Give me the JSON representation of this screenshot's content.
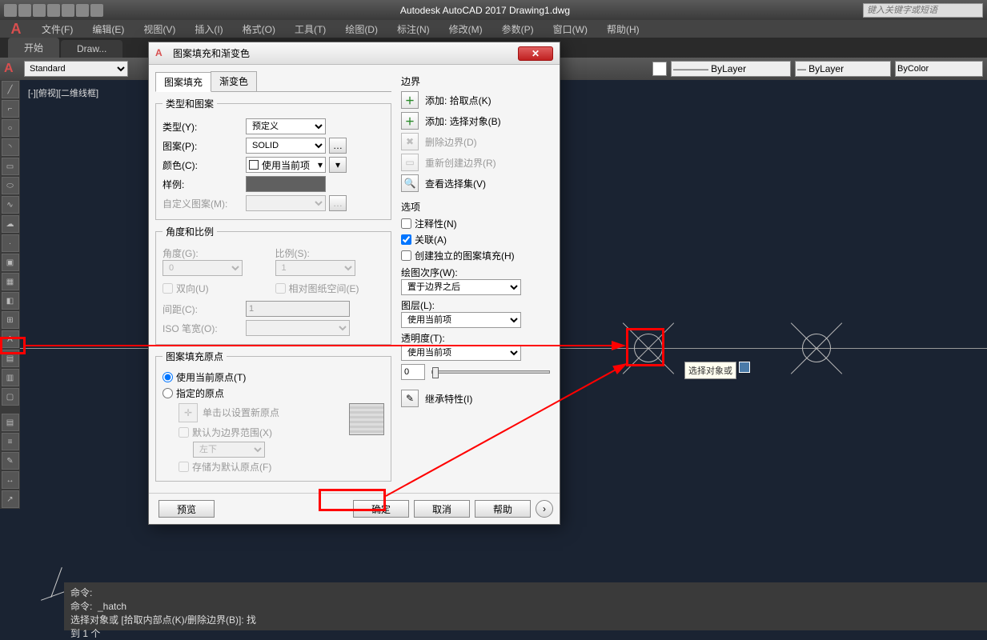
{
  "titlebar": {
    "title": "Autodesk AutoCAD 2017   Drawing1.dwg",
    "search_placeholder": "键入关键字或短语"
  },
  "menu": {
    "items": [
      "文件(F)",
      "编辑(E)",
      "视图(V)",
      "插入(I)",
      "格式(O)",
      "工具(T)",
      "绘图(D)",
      "标注(N)",
      "修改(M)",
      "参数(P)",
      "窗口(W)",
      "帮助(H)"
    ]
  },
  "tabs": {
    "start": "开始",
    "current": "Draw..."
  },
  "ribbon": {
    "style": "Standard",
    "layer": "ByLayer",
    "lineweight": "ByLayer",
    "color": "ByColor"
  },
  "viewport_label": "[-][俯视][二维线框]",
  "dialog": {
    "title": "图案填充和渐变色",
    "tabs": {
      "hatch": "图案填充",
      "gradient": "渐变色"
    },
    "type_group": {
      "legend": "类型和图案",
      "type_label": "类型(Y):",
      "type_value": "预定义",
      "pattern_label": "图案(P):",
      "pattern_value": "SOLID",
      "color_label": "颜色(C):",
      "color_value": "使用当前项",
      "sample_label": "样例:",
      "custom_label": "自定义图案(M):"
    },
    "angle_group": {
      "legend": "角度和比例",
      "angle_label": "角度(G):",
      "angle_value": "0",
      "scale_label": "比例(S):",
      "scale_value": "1",
      "double_label": "双向(U)",
      "relpaper_label": "相对图纸空间(E)",
      "spacing_label": "间距(C):",
      "spacing_value": "1",
      "iso_label": "ISO 笔宽(O):"
    },
    "origin_group": {
      "legend": "图案填充原点",
      "use_current": "使用当前原点(T)",
      "specified": "指定的原点",
      "click_set": "单击以设置新原点",
      "default_extent": "默认为边界范围(X)",
      "default_pos": "左下",
      "store_default": "存储为默认原点(F)"
    },
    "boundary": {
      "legend": "边界",
      "add_pick": "添加: 拾取点(K)",
      "add_select": "添加: 选择对象(B)",
      "remove": "删除边界(D)",
      "recreate": "重新创建边界(R)",
      "view_sel": "查看选择集(V)"
    },
    "options": {
      "legend": "选项",
      "annotative": "注释性(N)",
      "associative": "关联(A)",
      "separate": "创建独立的图案填充(H)",
      "draw_order_label": "绘图次序(W):",
      "draw_order_value": "置于边界之后",
      "layer_label": "图层(L):",
      "layer_value": "使用当前项",
      "transparency_label": "透明度(T):",
      "transparency_value": "使用当前项",
      "transparency_num": "0"
    },
    "inherit": "继承特性(I)",
    "footer": {
      "preview": "预览",
      "ok": "确定",
      "cancel": "取消",
      "help": "帮助"
    }
  },
  "tooltip": "选择对象或",
  "cmd": {
    "l1": "命令:",
    "l2": "命令:  _hatch",
    "l3": "选择对象或 [拾取内部点(K)/删除边界(B)]: 找",
    "l4": "到 1 个"
  }
}
